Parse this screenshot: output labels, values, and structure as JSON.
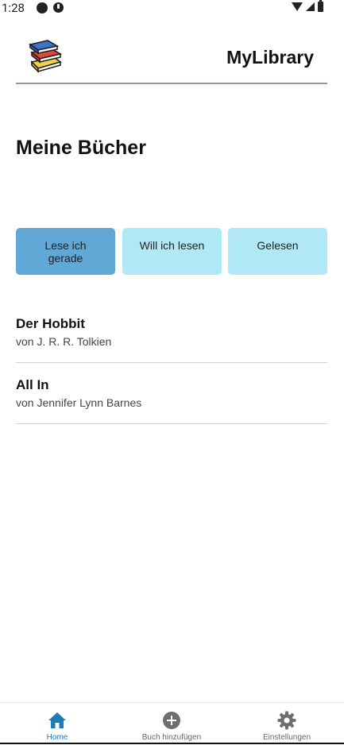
{
  "status_bar": {
    "time": "1:28"
  },
  "header": {
    "title": "MyLibrary",
    "logo_icon": "books-stack-icon"
  },
  "page": {
    "title": "Meine Bücher"
  },
  "filters": [
    {
      "label": "Lese ich gerade",
      "active": true
    },
    {
      "label": "Will ich lesen",
      "active": false
    },
    {
      "label": "Gelesen",
      "active": false
    }
  ],
  "books": [
    {
      "title": "Der Hobbit",
      "author": "von J. R. R. Tolkien"
    },
    {
      "title": "All In",
      "author": "von Jennifer Lynn Barnes"
    }
  ],
  "bottom_nav": [
    {
      "label": "Home",
      "icon": "home-icon",
      "active": true
    },
    {
      "label": "Buch hinzufügen",
      "icon": "add-circle-icon",
      "active": false
    },
    {
      "label": "Einstellungen",
      "icon": "gear-icon",
      "active": false
    }
  ],
  "colors": {
    "accent": "#1f7ab8",
    "filter_active": "#62a8d6",
    "filter_inactive": "#b0e8f5",
    "header_divider": "#a89088"
  }
}
